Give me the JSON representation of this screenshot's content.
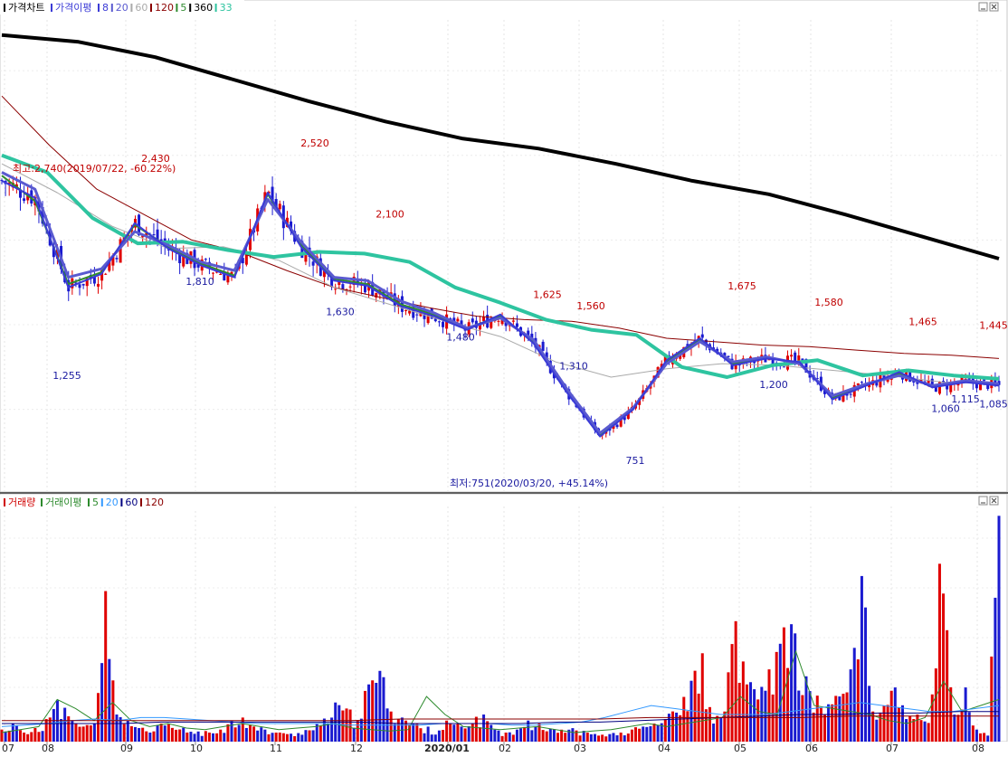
{
  "legend_price": {
    "items": [
      {
        "label": "가격차트",
        "color": "#000000"
      },
      {
        "label": "가격이평",
        "color": "#3b3bd6"
      },
      {
        "label": "8",
        "color": "#3b3bd6"
      },
      {
        "label": "20",
        "color": "#5a5ad0"
      },
      {
        "label": "60",
        "color": "#aaaaaa"
      },
      {
        "label": "120",
        "color": "#8b0000"
      },
      {
        "label": "5",
        "color": "#2e8b2e"
      },
      {
        "label": "360",
        "color": "#000000"
      },
      {
        "label": "33",
        "color": "#2ec4a0"
      }
    ]
  },
  "legend_volume": {
    "items": [
      {
        "label": "거래량",
        "color": "#d00000"
      },
      {
        "label": "거래이평",
        "color": "#2e8b2e"
      },
      {
        "label": "5",
        "color": "#2e8b2e"
      },
      {
        "label": "20",
        "color": "#3399ff"
      },
      {
        "label": "60",
        "color": "#000080"
      },
      {
        "label": "120",
        "color": "#8b0000"
      }
    ]
  },
  "annotations": {
    "high_note": "최고:2,740(2019/07/22, -60.22%)",
    "low_note": "최저:751(2020/03/20, +45.14%)"
  },
  "chart_data": [
    {
      "type": "candlestick",
      "name": "price",
      "y_range": [
        640,
        3300
      ],
      "x_ticks": [
        "07",
        "08",
        "09",
        "10",
        "11",
        "12",
        "2020/01",
        "02",
        "03",
        "04",
        "05",
        "06",
        "07",
        "08"
      ],
      "peak_labels": [
        {
          "label": "2,430",
          "value": 2430,
          "kind": "high"
        },
        {
          "label": "2,520",
          "value": 2520,
          "kind": "high"
        },
        {
          "label": "2,100",
          "value": 2100,
          "kind": "high"
        },
        {
          "label": "1,625",
          "value": 1625,
          "kind": "high"
        },
        {
          "label": "1,560",
          "value": 1560,
          "kind": "high"
        },
        {
          "label": "1,675",
          "value": 1675,
          "kind": "high"
        },
        {
          "label": "1,580",
          "value": 1580,
          "kind": "high"
        },
        {
          "label": "1,465",
          "value": 1465,
          "kind": "high"
        },
        {
          "label": "1,445",
          "value": 1445,
          "kind": "high"
        },
        {
          "label": "1,255",
          "value": 1255,
          "kind": "low"
        },
        {
          "label": "1,810",
          "value": 1810,
          "kind": "low"
        },
        {
          "label": "1,630",
          "value": 1630,
          "kind": "low"
        },
        {
          "label": "1,480",
          "value": 1480,
          "kind": "low"
        },
        {
          "label": "1,310",
          "value": 1310,
          "kind": "low"
        },
        {
          "label": "751",
          "value": 751,
          "kind": "low"
        },
        {
          "label": "1,200",
          "value": 1200,
          "kind": "low"
        },
        {
          "label": "1,060",
          "value": 1060,
          "kind": "low"
        },
        {
          "label": "1,115",
          "value": 1115,
          "kind": "low"
        },
        {
          "label": "1,085",
          "value": 1085,
          "kind": "last"
        }
      ],
      "series": [
        {
          "name": "360",
          "color": "#000000",
          "points": [
            3210,
            3170,
            3080,
            2950,
            2820,
            2700,
            2600,
            2540,
            2450,
            2350,
            2270,
            2150,
            2020,
            1890
          ]
        },
        {
          "name": "120",
          "color": "#8b0000",
          "points": [
            2850,
            2560,
            2300,
            2150,
            2000,
            1930,
            1820,
            1720,
            1660,
            1600,
            1550,
            1530,
            1520,
            1480,
            1420,
            1400,
            1380,
            1370,
            1350,
            1330,
            1320,
            1300
          ]
        },
        {
          "name": "60",
          "color": "#aaaaaa",
          "points": [
            2450,
            2280,
            2080,
            1950,
            1960,
            1880,
            1720,
            1620,
            1520,
            1430,
            1280,
            1190,
            1240,
            1270,
            1260,
            1230,
            1200,
            1160,
            1150
          ]
        },
        {
          "name": "33",
          "color": "#2ec4a0",
          "points": [
            2500,
            2400,
            2130,
            1980,
            1990,
            1940,
            1900,
            1930,
            1920,
            1870,
            1720,
            1630,
            1530,
            1470,
            1440,
            1250,
            1190,
            1260,
            1290,
            1200,
            1230,
            1200,
            1180
          ]
        },
        {
          "name": "20",
          "color": "#5a5ad0",
          "points": [
            2400,
            2300,
            1780,
            1830,
            2050,
            1970,
            1870,
            1820,
            2240,
            1990,
            1780,
            1760,
            1640,
            1570,
            1480,
            1540,
            1410,
            1120,
            860,
            1010,
            1270,
            1400,
            1280,
            1310,
            1270,
            1080,
            1150,
            1200,
            1140,
            1170,
            1150
          ]
        },
        {
          "name": "8",
          "color": "#3b3bd6",
          "points": [
            2350,
            2250,
            1720,
            1800,
            2100,
            1950,
            1850,
            1780,
            2280,
            1960,
            1760,
            1730,
            1610,
            1550,
            1470,
            1560,
            1390,
            1100,
            840,
            1000,
            1290,
            1420,
            1260,
            1300,
            1280,
            1060,
            1140,
            1220,
            1130,
            1160,
            1140
          ]
        },
        {
          "name": "5",
          "color": "#2e8b2e",
          "points": [
            2380,
            2230,
            1740,
            1810,
            2090,
            1960,
            1860,
            1790,
            2270,
            1970,
            1770,
            1740,
            1620,
            1560,
            1480,
            1550,
            1400,
            1110,
            850,
            1005,
            1280,
            1410,
            1270,
            1305,
            1275,
            1070,
            1145,
            1210,
            1135,
            1165,
            1145
          ]
        }
      ]
    },
    {
      "type": "bar",
      "name": "volume",
      "series": [
        {
          "name": "거래량",
          "values": [
            8,
            12,
            6,
            9,
            15,
            28,
            14,
            10,
            12,
            100,
            18,
            14,
            9,
            6,
            12,
            10,
            8,
            7,
            6,
            8,
            14,
            16,
            10,
            8,
            6,
            5,
            7,
            9,
            12,
            26,
            22,
            14,
            38,
            47,
            20,
            16,
            12,
            9,
            8,
            14,
            10,
            12,
            18,
            8,
            6,
            8,
            14,
            12,
            10,
            9,
            8,
            6,
            4,
            5,
            6,
            8,
            10,
            12,
            15,
            22,
            35,
            60,
            12,
            20,
            80,
            38,
            28,
            48,
            65,
            78,
            40,
            30,
            26,
            30,
            48,
            110,
            20,
            24,
            36,
            15,
            18,
            12,
            140,
            18,
            36,
            8,
            4,
            150
          ]
        },
        {
          "name": "5",
          "values": [
            6,
            8,
            10,
            28,
            22,
            14,
            26,
            14,
            10,
            12,
            9,
            8,
            10,
            12,
            10,
            8,
            9,
            10,
            12,
            9,
            8,
            7,
            8,
            30,
            18,
            10,
            9,
            8,
            9,
            10,
            8,
            6,
            7,
            8,
            10,
            12,
            10,
            12,
            14,
            16,
            30,
            20,
            18,
            60,
            24,
            22,
            20,
            18,
            14,
            12,
            16,
            40,
            20,
            24,
            28
          ]
        },
        {
          "name": "20",
          "values": [
            10,
            11,
            12,
            14,
            15,
            14,
            16,
            16,
            15,
            14,
            13,
            12,
            12,
            12,
            12,
            11,
            11,
            11,
            11,
            12,
            12,
            12,
            11,
            11,
            12,
            13,
            16,
            20,
            24,
            22,
            20,
            18,
            18,
            18,
            20,
            22,
            24,
            26,
            24,
            22,
            20,
            20,
            22,
            24
          ]
        },
        {
          "name": "60",
          "values": [
            12,
            12,
            12,
            12,
            13,
            13,
            13,
            13,
            13,
            13,
            12,
            12,
            12,
            12,
            13,
            13,
            14,
            15,
            16,
            17,
            18,
            18,
            19,
            19,
            20,
            20
          ]
        },
        {
          "name": "120",
          "values": [
            14,
            14,
            14,
            14,
            14,
            14,
            14,
            14,
            15,
            15,
            15,
            15,
            15,
            16,
            16,
            16,
            16,
            17,
            17,
            17,
            17
          ]
        }
      ]
    }
  ]
}
